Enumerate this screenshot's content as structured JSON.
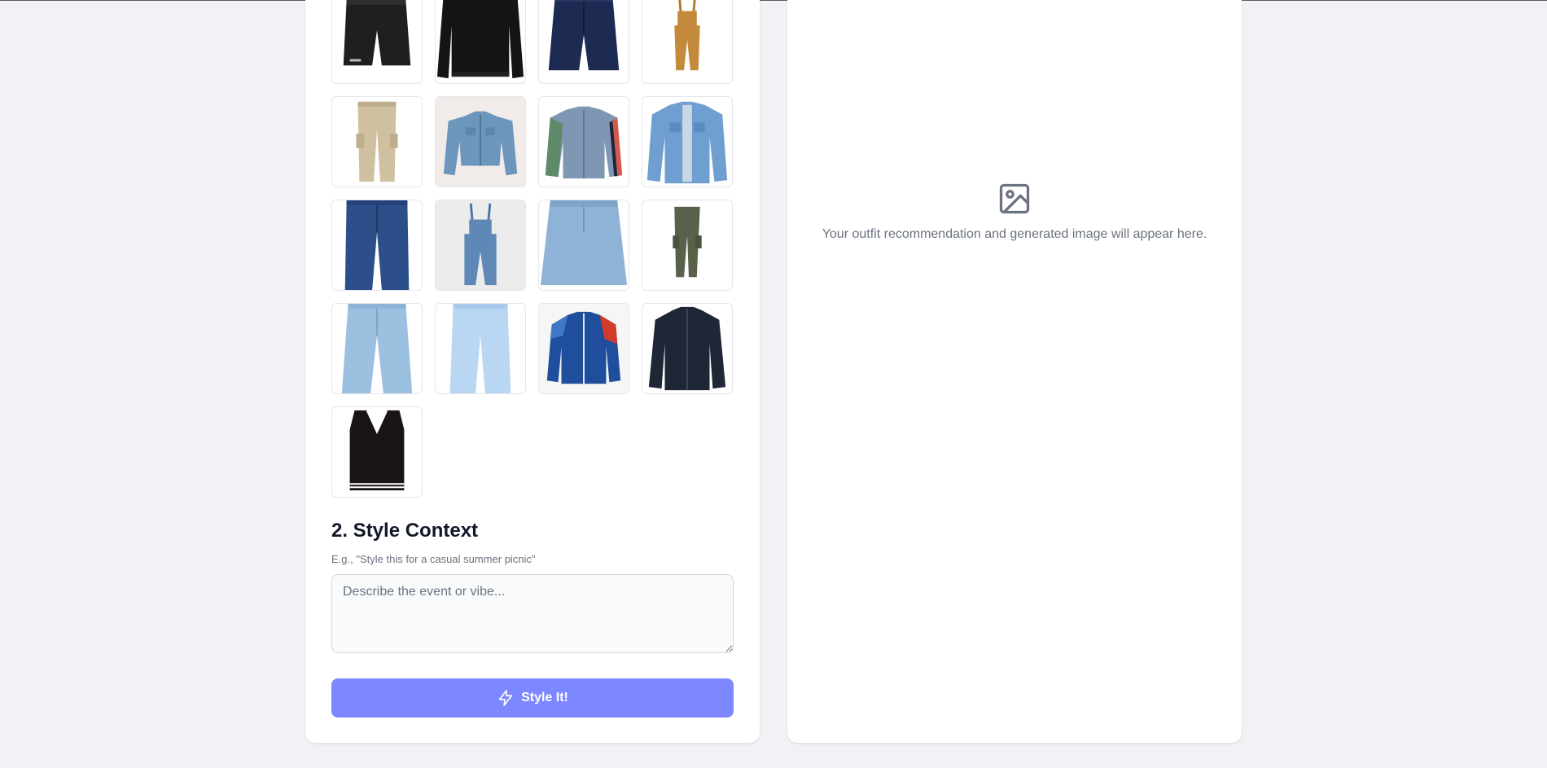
{
  "wardrobe": {
    "items": [
      {
        "icon": "black-shorts-icon"
      },
      {
        "icon": "black-sweatshirt-icon"
      },
      {
        "icon": "navy-shorts-icon"
      },
      {
        "icon": "tan-overalls-icon"
      },
      {
        "icon": "khaki-cargo-pants-icon"
      },
      {
        "icon": "cropped-denim-jacket-icon"
      },
      {
        "icon": "star-sleeve-denim-jacket-icon"
      },
      {
        "icon": "light-denim-jacket-icon"
      },
      {
        "icon": "dark-jeans-icon"
      },
      {
        "icon": "denim-overalls-icon"
      },
      {
        "icon": "denim-skirt-icon"
      },
      {
        "icon": "olive-cargo-pants-icon"
      },
      {
        "icon": "light-wash-jeans-icon"
      },
      {
        "icon": "pale-blue-jeans-icon"
      },
      {
        "icon": "track-jacket-icon"
      },
      {
        "icon": "navy-zip-jacket-icon"
      },
      {
        "icon": "black-sweater-vest-icon"
      }
    ]
  },
  "context": {
    "title": "2. Style Context",
    "hint": "E.g., \"Style this for a casual summer picnic\"",
    "placeholder": "Describe the event or vibe...",
    "value": ""
  },
  "action": {
    "label": "Style It!",
    "icon": "lightning-icon"
  },
  "result": {
    "icon": "image-icon",
    "placeholder": "Your outfit recommendation and generated image will appear here."
  },
  "colors": {
    "accent": "#7d87ff",
    "background": "#f1f2f5",
    "card": "#ffffff"
  }
}
